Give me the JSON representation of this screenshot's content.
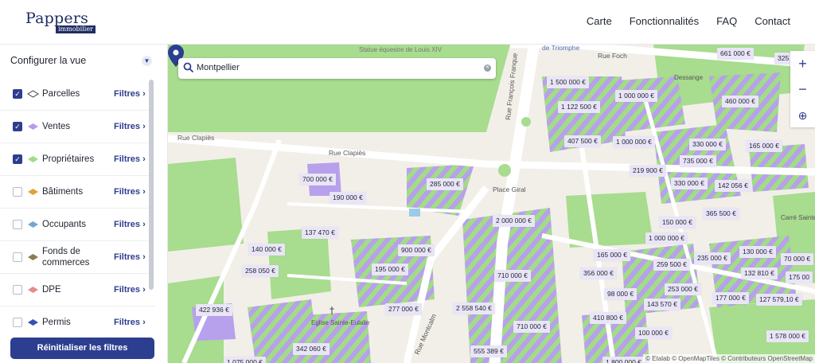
{
  "header": {
    "logo_main": "Pappers",
    "logo_sub": "immobilier",
    "nav": [
      "Carte",
      "Fonctionnalités",
      "FAQ",
      "Contact"
    ]
  },
  "sidebar": {
    "title": "Configurer la vue",
    "filters_label": "Filtres",
    "layers": [
      {
        "name": "Parcelles",
        "checked": true,
        "icon": "parcel-outline-icon",
        "color": "#ffffff"
      },
      {
        "name": "Ventes",
        "checked": true,
        "icon": "sales-diamond-icon",
        "color": "#b89ce8"
      },
      {
        "name": "Propriétaires",
        "checked": true,
        "icon": "owners-diamond-icon",
        "color": "#9fdc8a"
      },
      {
        "name": "Bâtiments",
        "checked": false,
        "icon": "buildings-diamond-icon",
        "color": "#e3a13a"
      },
      {
        "name": "Occupants",
        "checked": false,
        "icon": "occupants-diamond-icon",
        "color": "#6fa8d8"
      },
      {
        "name": "Fonds de commerces",
        "checked": false,
        "icon": "fonds-diamond-icon",
        "color": "#8a7d4a"
      },
      {
        "name": "DPE",
        "checked": false,
        "icon": "dpe-diamond-icon",
        "color": "#e58c8c"
      },
      {
        "name": "Permis",
        "checked": false,
        "icon": "permis-diamond-icon",
        "color": "#3a4fb0"
      }
    ],
    "reset_label": "Réinitialiser les filtres"
  },
  "map": {
    "search_value": "Montpellier",
    "attribution": "© Etalab © OpenMapTiles © Contributeurs OpenStreetMap",
    "streets": [
      "Rue Clapiès",
      "Rue Clapiès",
      "Rue François Franque",
      "Rue Foch",
      "Place Giral",
      "Rue Montcalm",
      "de Triomphe",
      "Statue équestre de Louis XIV",
      "Dessange",
      "Eglise Sainte-Eulalie",
      "Carré Sainte"
    ],
    "price_labels": [
      "661 000 €",
      "325 €",
      "1 500 000 €",
      "1 000 000 €",
      "1 122 500 €",
      "460 000 €",
      "407 500 €",
      "1 000 000 €",
      "330 000 €",
      "165 000 €",
      "219 900 €",
      "735 000 €",
      "700 000 €",
      "285 000 €",
      "190 000 €",
      "330 000 €",
      "142 056 €",
      "365 500 €",
      "2 000 000 €",
      "150 000 €",
      "1 000 000 €",
      "137 470 €",
      "140 000 €",
      "900 000 €",
      "165 000 €",
      "235 000 €",
      "130 000 €",
      "70 000 €",
      "259 500 €",
      "258 050 €",
      "195 000 €",
      "710 000 €",
      "356 000 €",
      "132 810 €",
      "175 00",
      "253 000 €",
      "98 000 €",
      "177 000 €",
      "127 579,10 €",
      "143 570 €",
      "422 936 €",
      "277 000 €",
      "2 558 540 €",
      "410 800 €",
      "710 000 €",
      "100 000 €",
      "1 578 000 €",
      "342 060 €",
      "555 389 €",
      "1 075 000 €",
      "1 800 000 €"
    ]
  }
}
